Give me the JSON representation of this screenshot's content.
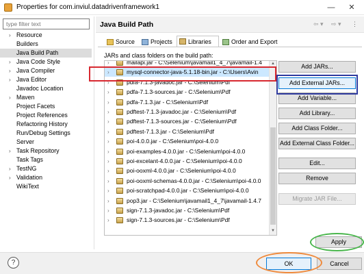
{
  "window": {
    "title": "Properties for com.inviul.datadrivenframework1",
    "minimize": "—",
    "close": "✕"
  },
  "filter": {
    "placeholder": "type filter text"
  },
  "nav": {
    "items": [
      {
        "label": "Resource",
        "arrow": "›"
      },
      {
        "label": "Builders",
        "arrow": ""
      },
      {
        "label": "Java Build Path",
        "arrow": "",
        "selected": true
      },
      {
        "label": "Java Code Style",
        "arrow": "›"
      },
      {
        "label": "Java Compiler",
        "arrow": "›"
      },
      {
        "label": "Java Editor",
        "arrow": "›"
      },
      {
        "label": "Javadoc Location",
        "arrow": ""
      },
      {
        "label": "Maven",
        "arrow": "›"
      },
      {
        "label": "Project Facets",
        "arrow": ""
      },
      {
        "label": "Project References",
        "arrow": ""
      },
      {
        "label": "Refactoring History",
        "arrow": ""
      },
      {
        "label": "Run/Debug Settings",
        "arrow": ""
      },
      {
        "label": "Server",
        "arrow": ""
      },
      {
        "label": "Task Repository",
        "arrow": "›"
      },
      {
        "label": "Task Tags",
        "arrow": ""
      },
      {
        "label": "TestNG",
        "arrow": "›"
      },
      {
        "label": "Validation",
        "arrow": "›"
      },
      {
        "label": "WikiText",
        "arrow": ""
      }
    ]
  },
  "header": {
    "title": "Java Build Path",
    "back": "⇦ ▾",
    "forward": "⇨ ▾",
    "menu": "⋮"
  },
  "tabs": [
    {
      "label": "Source",
      "active": false
    },
    {
      "label": "Projects",
      "active": false
    },
    {
      "label": "Libraries",
      "active": true
    },
    {
      "label": "Order and Export",
      "active": false
    }
  ],
  "jars_label": "JARs and class folders on the build path:",
  "jars": [
    {
      "label": "mailapi.jar - C:\\Selenium\\javamail1_4_7\\javamail-1.4",
      "selected": false
    },
    {
      "label": "mysql-connector-java-5.1.18-bin.jar - C:\\Users\\Avin",
      "selected": true
    },
    {
      "label": "pdfa-7.1.3-javadoc.jar - C:\\Selenium\\Pdf",
      "selected": false
    },
    {
      "label": "pdfa-7.1.3-sources.jar - C:\\Selenium\\Pdf",
      "selected": false
    },
    {
      "label": "pdfa-7.1.3.jar - C:\\Selenium\\Pdf",
      "selected": false
    },
    {
      "label": "pdftest-7.1.3-javadoc.jar - C:\\Selenium\\Pdf",
      "selected": false
    },
    {
      "label": "pdftest-7.1.3-sources.jar - C:\\Selenium\\Pdf",
      "selected": false
    },
    {
      "label": "pdftest-7.1.3.jar - C:\\Selenium\\Pdf",
      "selected": false
    },
    {
      "label": "poi-4.0.0.jar - C:\\Selenium\\poi-4.0.0",
      "selected": false
    },
    {
      "label": "poi-examples-4.0.0.jar - C:\\Selenium\\poi-4.0.0",
      "selected": false
    },
    {
      "label": "poi-excelant-4.0.0.jar - C:\\Selenium\\poi-4.0.0",
      "selected": false
    },
    {
      "label": "poi-ooxml-4.0.0.jar - C:\\Selenium\\poi-4.0.0",
      "selected": false
    },
    {
      "label": "poi-ooxml-schemas-4.0.0.jar - C:\\Selenium\\poi-4.0.0",
      "selected": false
    },
    {
      "label": "poi-scratchpad-4.0.0.jar - C:\\Selenium\\poi-4.0.0",
      "selected": false
    },
    {
      "label": "pop3.jar - C:\\Selenium\\javamail1_4_7\\javamail-1.4.7",
      "selected": false
    },
    {
      "label": "sign-7.1.3-javadoc.jar - C:\\Selenium\\Pdf",
      "selected": false
    },
    {
      "label": "sign-7.1.3-sources.jar - C:\\Selenium\\Pdf",
      "selected": false
    }
  ],
  "buttons": {
    "add_jars": "Add JARs...",
    "add_external_jars": "Add External JARs...",
    "add_variable": "Add Variable...",
    "add_library": "Add Library...",
    "add_class_folder": "Add Class Folder...",
    "add_external_class_folder": "Add External Class Folder...",
    "edit": "Edit...",
    "remove": "Remove",
    "migrate_jar": "Migrate JAR File...",
    "apply": "Apply",
    "ok": "OK",
    "cancel": "Cancel",
    "help": "?"
  },
  "annotation_colors": {
    "red": "#d7282f",
    "blue": "#2e3a9e",
    "green": "#49b64c",
    "orange": "#ef8a3c"
  }
}
